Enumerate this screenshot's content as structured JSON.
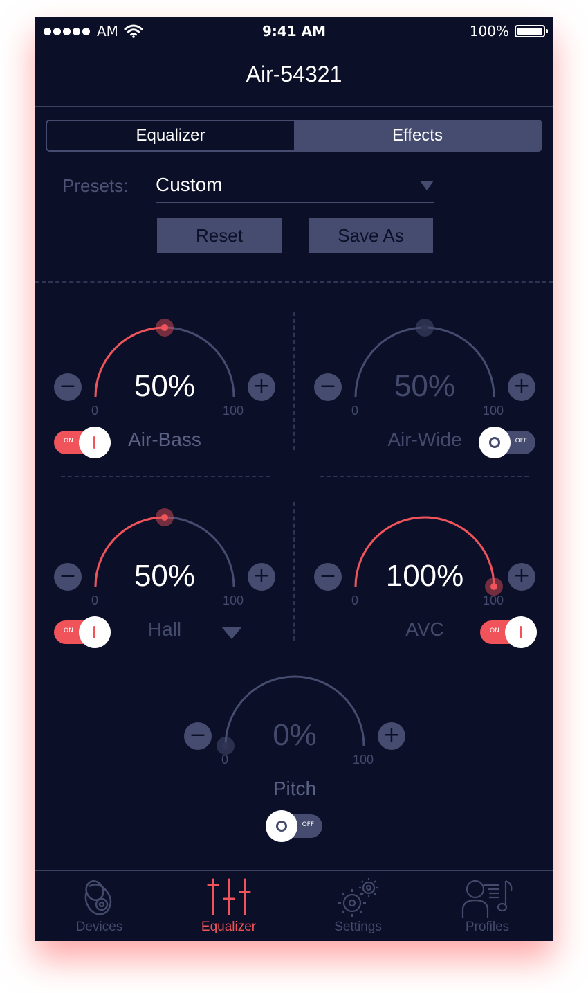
{
  "status_bar": {
    "carrier": "AM",
    "time": "9:41 AM",
    "battery": "100%"
  },
  "nav": {
    "title": "Air-54321"
  },
  "segments": {
    "equalizer": "Equalizer",
    "effects": "Effects"
  },
  "presets": {
    "label": "Presets:",
    "value": "Custom"
  },
  "buttons": {
    "reset": "Reset",
    "save_as": "Save As"
  },
  "effects": {
    "air_bass": {
      "label": "Air-Bass",
      "value": "50%",
      "level": 0.5,
      "min": "0",
      "max": "100",
      "toggle": "ON",
      "enabled": true
    },
    "air_wide": {
      "label": "Air-Wide",
      "value": "50%",
      "level": 0.5,
      "min": "0",
      "max": "100",
      "toggle": "OFF",
      "enabled": false
    },
    "hall": {
      "label": "Hall",
      "value": "50%",
      "level": 0.5,
      "min": "0",
      "max": "100",
      "toggle": "ON",
      "enabled": true
    },
    "avc": {
      "label": "AVC",
      "value": "100%",
      "level": 1.0,
      "min": "0",
      "max": "100",
      "toggle": "ON",
      "enabled": true
    },
    "pitch": {
      "label": "Pitch",
      "value": "0%",
      "level": 0.0,
      "min": "0",
      "max": "100",
      "toggle": "OFF",
      "enabled": false
    }
  },
  "stepper": {
    "minus": "−",
    "plus": "+"
  },
  "colors": {
    "accent": "#f0535a",
    "track": "#454c6f",
    "background": "#0b0f27"
  },
  "tabbar": {
    "devices": "Devices",
    "equalizer": "Equalizer",
    "settings": "Settings",
    "profiles": "Profiles"
  }
}
